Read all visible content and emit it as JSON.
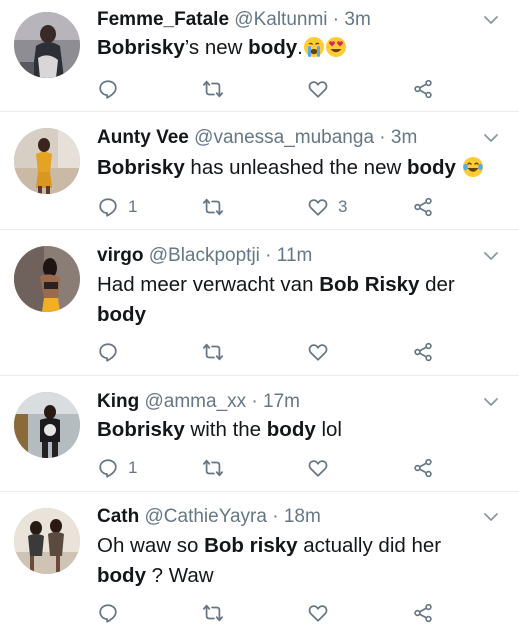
{
  "tweets": [
    {
      "display_name": "Femme_Fatale",
      "handle": "@Kaltunmi",
      "sep": " · ",
      "time": "3m",
      "text_parts": [
        {
          "t": "Bobrisky",
          "b": true
        },
        {
          "t": "’s new ",
          "b": false
        },
        {
          "t": "body",
          "b": true
        },
        {
          "t": ".",
          "b": false
        }
      ],
      "emojis": [
        "crying-face",
        "heart-eyes-face"
      ],
      "counts": {
        "reply": "",
        "retweet": "",
        "like": ""
      }
    },
    {
      "display_name": "Aunty Vee",
      "handle": "@vanessa_mubanga",
      "sep": " · ",
      "time": "3m",
      "text_parts": [
        {
          "t": "Bobrisky",
          "b": true
        },
        {
          "t": " has unleashed the new ",
          "b": false
        },
        {
          "t": "body",
          "b": true
        }
      ],
      "emojis": [
        "tears-of-joy-face"
      ],
      "counts": {
        "reply": "1",
        "retweet": "",
        "like": "3"
      }
    },
    {
      "display_name": "virgo",
      "handle": "@Blackpoptji",
      "sep": " · ",
      "time": "11m",
      "text_parts": [
        {
          "t": "Had meer verwacht van ",
          "b": false
        },
        {
          "t": "Bob Risky",
          "b": true
        },
        {
          "t": " der ",
          "b": false
        },
        {
          "t": "body",
          "b": true
        }
      ],
      "emojis": [],
      "counts": {
        "reply": "",
        "retweet": "",
        "like": ""
      }
    },
    {
      "display_name": "King",
      "handle": "@amma_xx",
      "sep": " · ",
      "time": "17m",
      "text_parts": [
        {
          "t": "Bobrisky",
          "b": true
        },
        {
          "t": " with the ",
          "b": false
        },
        {
          "t": "body",
          "b": true
        },
        {
          "t": " lol",
          "b": false
        }
      ],
      "emojis": [],
      "counts": {
        "reply": "1",
        "retweet": "",
        "like": ""
      }
    },
    {
      "display_name": "Cath",
      "handle": "@CathieYayra",
      "sep": " · ",
      "time": "18m",
      "text_parts": [
        {
          "t": "Oh waw so ",
          "b": false
        },
        {
          "t": "Bob risky",
          "b": true
        },
        {
          "t": " actually did her ",
          "b": false
        },
        {
          "t": "body",
          "b": true
        },
        {
          "t": " ? Waw",
          "b": false
        }
      ],
      "emojis": [],
      "counts": {
        "reply": "",
        "retweet": "",
        "like": ""
      }
    }
  ],
  "icons": {
    "reply": "reply-icon",
    "retweet": "retweet-icon",
    "like": "like-icon",
    "share": "share-icon",
    "menu": "chevron-down-icon"
  },
  "colors": {
    "text": "#14171a",
    "muted": "#657786",
    "divider": "#e6ecf0",
    "background": "#ffffff"
  }
}
